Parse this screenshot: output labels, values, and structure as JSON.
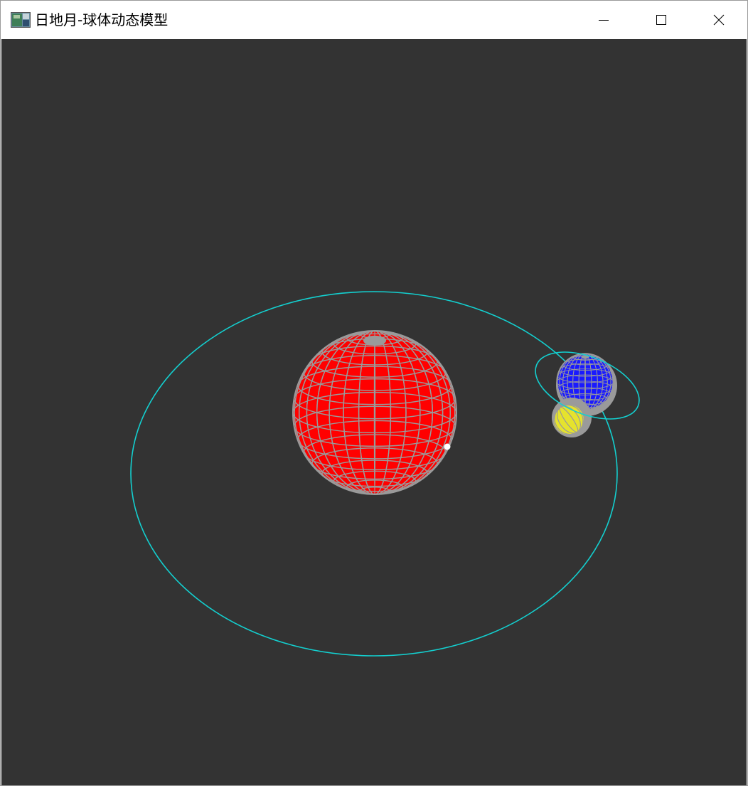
{
  "window": {
    "title": "日地月-球体动态模型",
    "app_icon": "opengl-window-icon",
    "controls": {
      "minimize_icon": "minimize-icon",
      "maximize_icon": "maximize-icon",
      "close_icon": "close-icon"
    }
  },
  "scene": {
    "background_color": "#333333",
    "orbit_color": "#13d0d0",
    "wireframe_color": "#9a9a9a",
    "bodies": [
      {
        "name": "sun",
        "color": "#ff0000"
      },
      {
        "name": "earth",
        "color": "#1a1aff"
      },
      {
        "name": "moon",
        "color": "#f2f01a"
      }
    ]
  }
}
